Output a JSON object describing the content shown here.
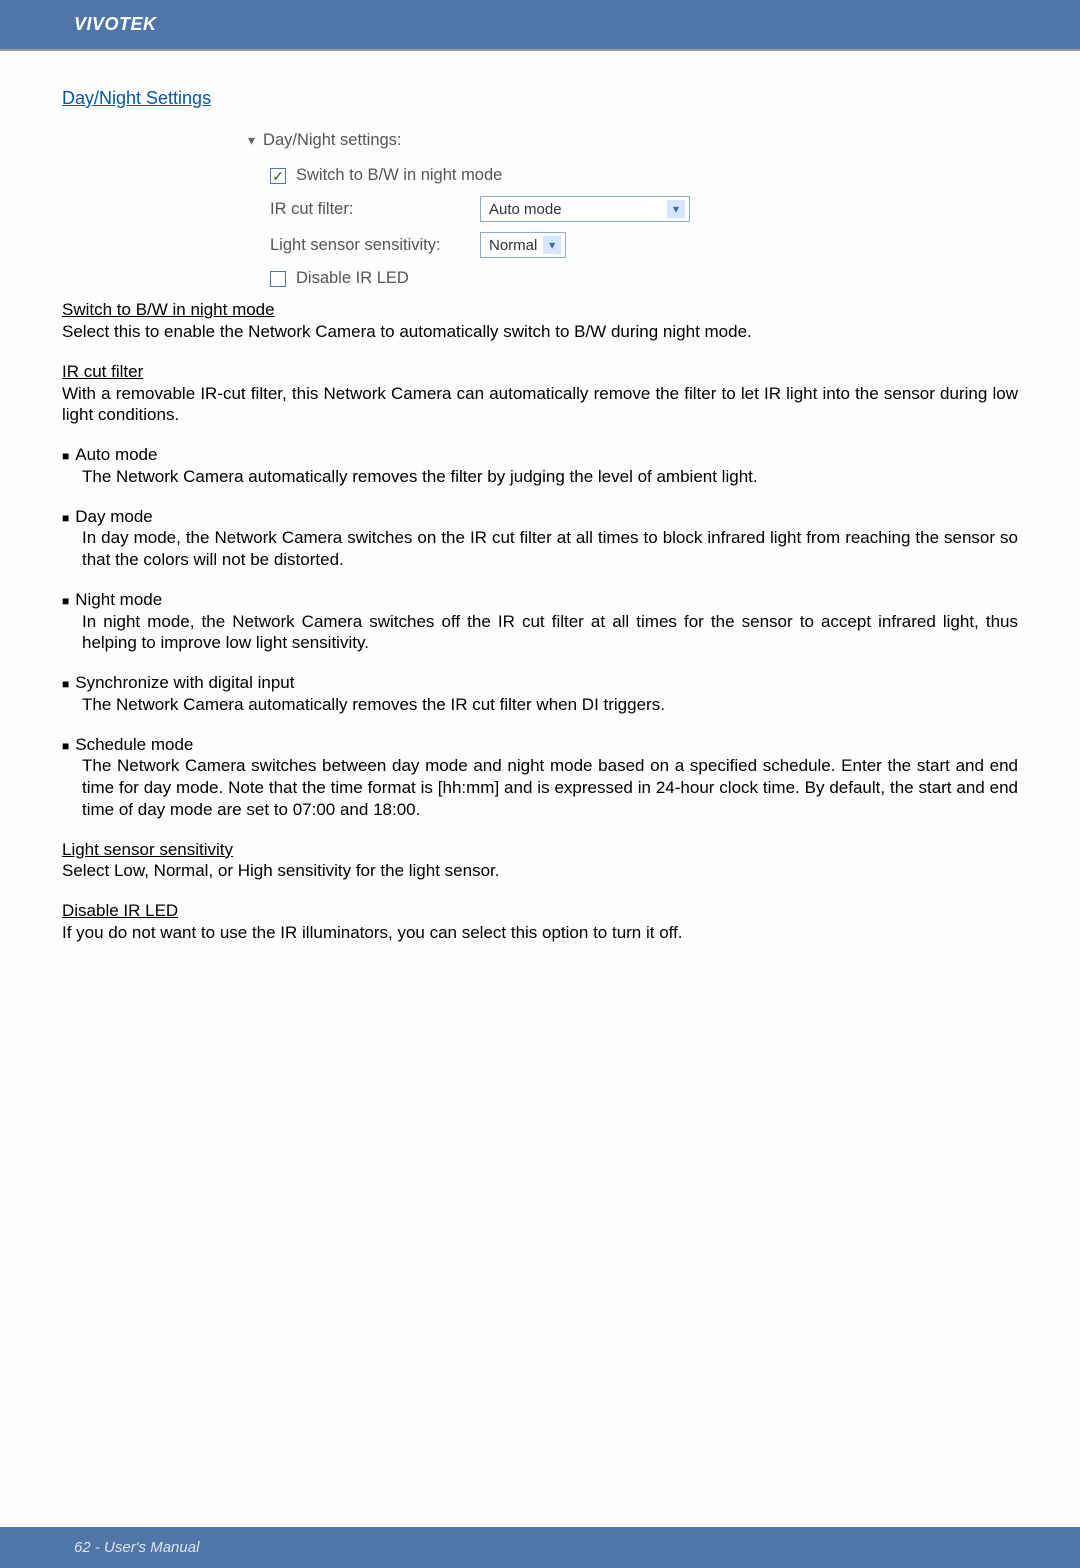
{
  "header": {
    "brand": "VIVOTEK"
  },
  "section": {
    "title": "Day/Night Settings"
  },
  "settings_ui": {
    "heading": "Day/Night settings:",
    "switch_bw": {
      "checked": true,
      "label": "Switch to B/W in night mode"
    },
    "ir_cut_filter": {
      "label": "IR cut filter:",
      "value": "Auto mode"
    },
    "light_sensor": {
      "label": "Light sensor sensitivity:",
      "value": "Normal"
    },
    "disable_ir": {
      "checked": false,
      "label": "Disable IR LED"
    }
  },
  "body": {
    "switch_bw": {
      "title": "Switch to B/W in night mode",
      "text": "Select this to enable the Network Camera to automatically switch to B/W during night mode."
    },
    "ir_cut_filter": {
      "title": "IR cut filter",
      "text": "With a removable IR-cut filter, this Network Camera can automatically remove the filter to let IR light into the sensor during low light conditions."
    },
    "modes": [
      {
        "name": "Auto mode",
        "desc": "The Network Camera automatically removes the filter by judging the level of ambient light."
      },
      {
        "name": "Day mode",
        "desc": "In day mode, the Network Camera switches on the IR cut filter at all times to block infrared light from reaching the sensor so that the colors will not be distorted."
      },
      {
        "name": "Night mode",
        "desc": "In night mode, the Network Camera switches off the IR cut filter at all times for the sensor to accept infrared light, thus helping to improve low light sensitivity."
      },
      {
        "name": "Synchronize with digital input",
        "desc": "The Network Camera automatically removes the IR cut filter when DI triggers."
      },
      {
        "name": "Schedule mode",
        "desc": "The Network Camera switches between day mode and night mode based on a specified schedule. Enter the start and end time for day mode. Note that the time format is [hh:mm] and is expressed in 24-hour clock time. By default, the start and end time of day mode are set to 07:00 and 18:00."
      }
    ],
    "light_sensor": {
      "title": "Light sensor sensitivity",
      "text": "Select Low, Normal, or High sensitivity for the light sensor."
    },
    "disable_ir": {
      "title": "Disable IR LED",
      "text": "If you do not want to use the IR illuminators, you can select this option to turn it off."
    }
  },
  "footer": {
    "text": "62 - User's Manual"
  }
}
